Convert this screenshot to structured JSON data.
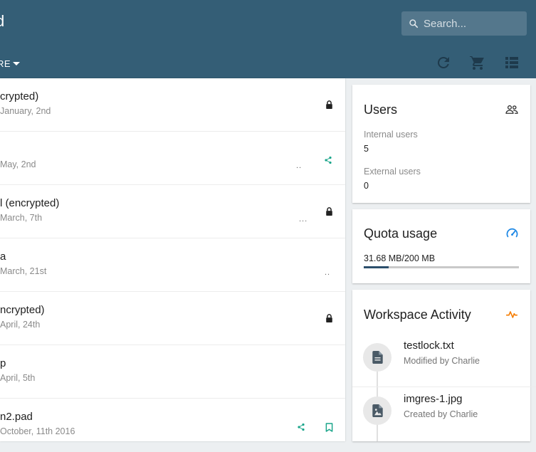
{
  "header": {
    "title_fragment": "d",
    "search": {
      "placeholder": "Search..."
    },
    "nav_more_label": "RE"
  },
  "list": {
    "rows": [
      {
        "title": "crypted)",
        "subtitle": "January, 2nd",
        "icon": "lock-icon",
        "dots": ""
      },
      {
        "title": "",
        "subtitle": "May, 2nd",
        "icon": "share-icon",
        "dots": ".."
      },
      {
        "title": "l (encrypted)",
        "subtitle": "March, 7th",
        "icon": "lock-icon",
        "dots": "..."
      },
      {
        "title": "a",
        "subtitle": "March, 21st",
        "icon": "",
        "dots": ".."
      },
      {
        "title": "ncrypted)",
        "subtitle": "April, 24th",
        "icon": "lock-icon",
        "dots": ""
      },
      {
        "title": "p",
        "subtitle": "April, 5th",
        "icon": "",
        "dots": ""
      },
      {
        "title": "n2.pad",
        "subtitle": "October, 11th 2016",
        "icon": "share-icon bookmark-icon",
        "dots": ""
      }
    ]
  },
  "users_card": {
    "title": "Users",
    "internal_label": "Internal users",
    "internal_value": "5",
    "external_label": "External users",
    "external_value": "0"
  },
  "quota_card": {
    "title": "Quota usage",
    "usage_text": "31.68 MB/200 MB",
    "usage_fraction": 0.1584
  },
  "activity_card": {
    "title": "Workspace Activity",
    "items": [
      {
        "name": "testlock.txt",
        "detail": "Modified by Charlie",
        "icon": "document-icon"
      },
      {
        "name": "imgres-1.jpg",
        "detail": "Created by Charlie",
        "icon": "image-file-icon"
      }
    ]
  },
  "colors": {
    "header_bg": "#345e76",
    "accent_teal": "#1aa58a",
    "accent_blue": "#1e88e5",
    "accent_orange": "#f57c00",
    "progress_fill": "#2c4f6c"
  }
}
